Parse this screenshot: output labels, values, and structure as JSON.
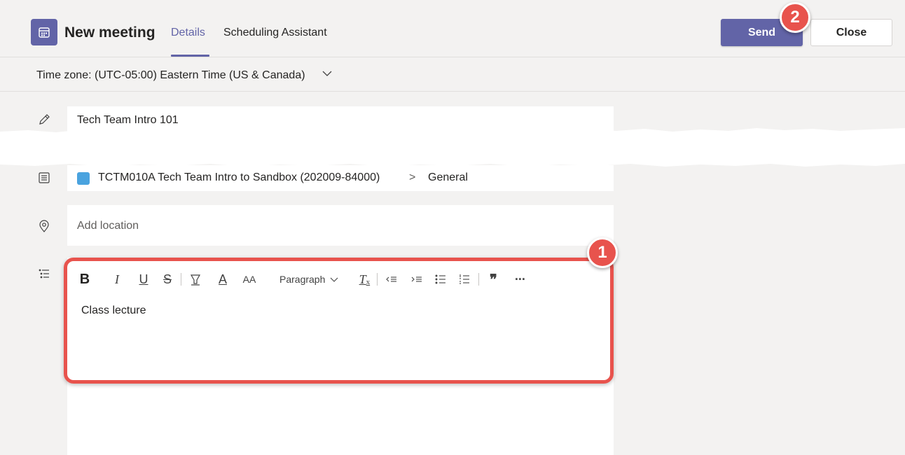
{
  "header": {
    "app_icon": "calendar-icon",
    "title": "New meeting",
    "tabs": [
      {
        "label": "Details",
        "active": true
      },
      {
        "label": "Scheduling Assistant",
        "active": false
      }
    ],
    "send_label": "Send",
    "close_label": "Close"
  },
  "timezone": {
    "label": "Time zone: (UTC-05:00) Eastern Time (US & Canada)",
    "icon": "chevron-down-icon"
  },
  "form": {
    "title_value": "Tech Team Intro 101",
    "title_icon": "pencil-icon",
    "channel_icon": "channel-list-icon",
    "channel_team": "TCTM010A Tech Team Intro to Sandbox (202009-84000)",
    "channel_separator": ">",
    "channel_name": "General",
    "location_icon": "location-pin-icon",
    "location_placeholder": "Add location",
    "details_icon": "bullet-list-icon"
  },
  "editor": {
    "toolbar": {
      "bold": "B",
      "italic": "I",
      "underline": "U",
      "strikethrough": "S",
      "highlight_icon": "highlighter-icon",
      "font_color": "A",
      "font_size": "AA",
      "paragraph": "Paragraph",
      "clear_format": "T",
      "decrease_indent_icon": "decrease-indent-icon",
      "increase_indent_icon": "increase-indent-icon",
      "bullets_icon": "bullets-icon",
      "numbering_icon": "numbering-icon",
      "quote": "❞",
      "more": "···"
    },
    "body": "Class lecture"
  },
  "callouts": {
    "one": "1",
    "two": "2"
  },
  "colors": {
    "accent": "#6264a7",
    "callout": "#e8534d"
  }
}
